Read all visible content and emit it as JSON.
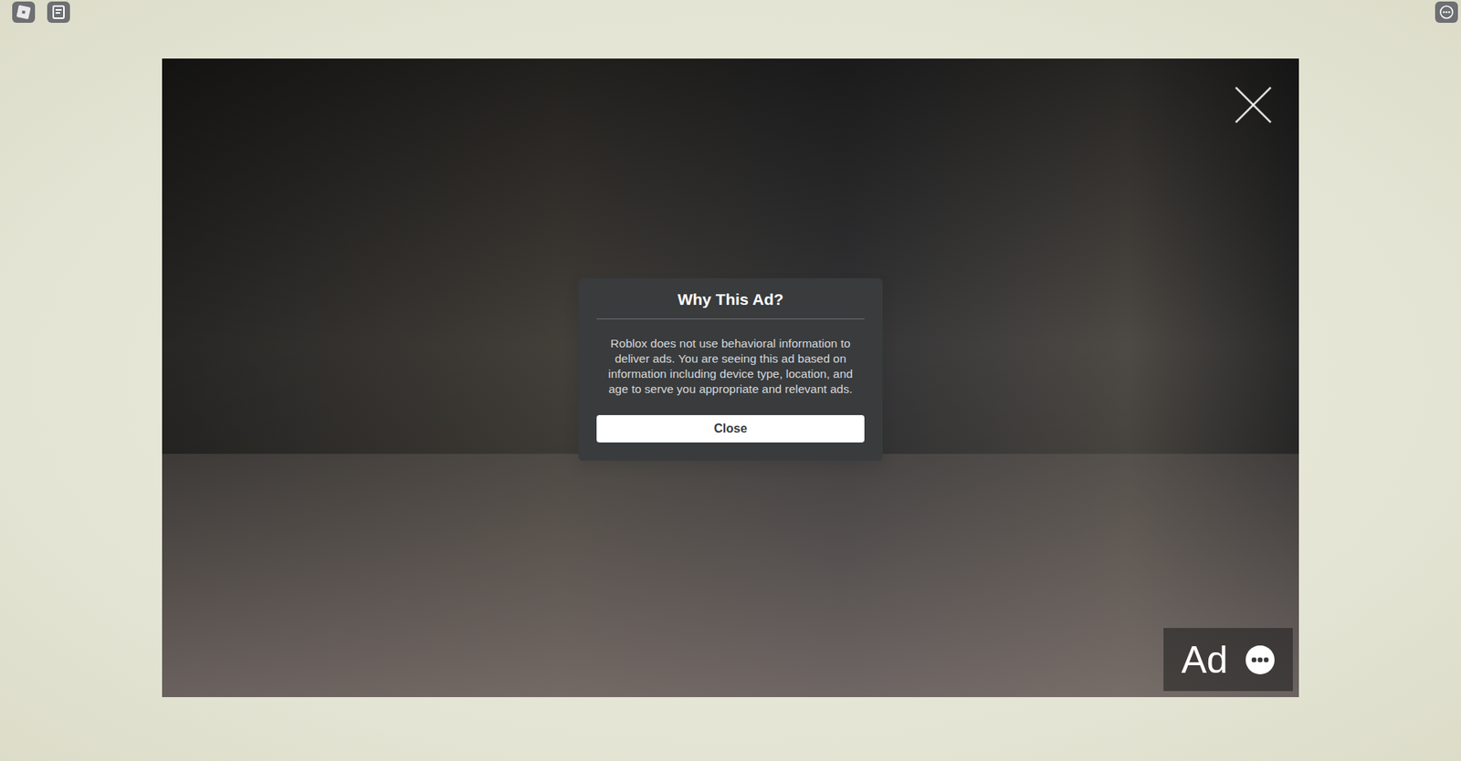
{
  "ad": {
    "label": "Ad"
  },
  "dialog": {
    "title": "Why This Ad?",
    "body": "Roblox does not use behavioral information to deliver ads. You are seeing this ad based on information including device type, location, and age to serve you appropriate and relevant ads.",
    "button": "Close"
  }
}
